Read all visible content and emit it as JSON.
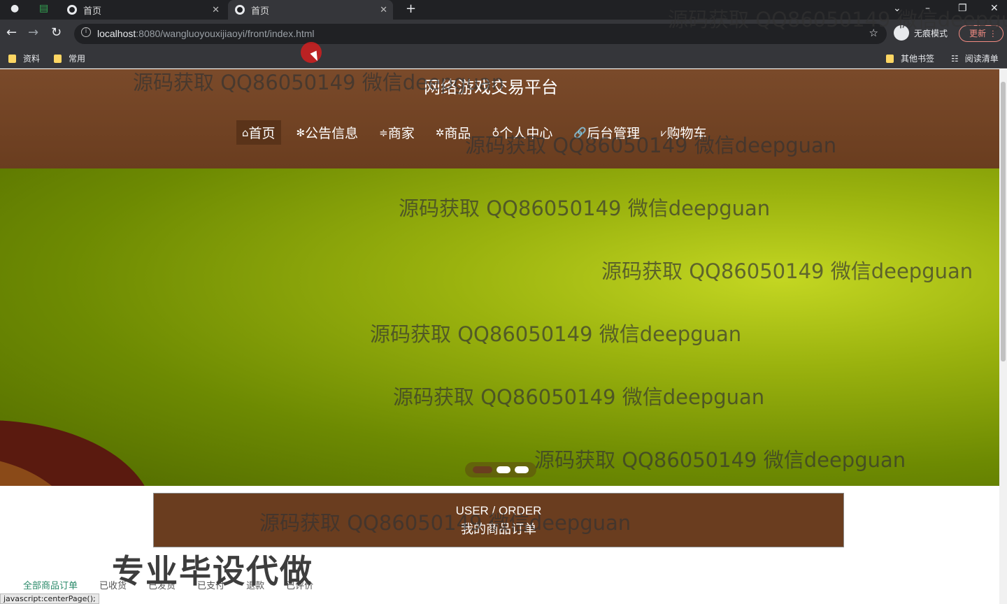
{
  "browser": {
    "tabs": [
      {
        "title": "首页",
        "active": false
      },
      {
        "title": "首页",
        "active": true
      }
    ],
    "url_host": "localhost",
    "url_path": ":8080/wangluoyouxijiaoyi/front/index.html",
    "incognito_label": "无痕模式",
    "update_label": "更新",
    "bookmarks": [
      "资料",
      "常用"
    ],
    "bookmarks_right": [
      "其他书签",
      "阅读清单"
    ],
    "status_text": "javascript:centerPage();"
  },
  "site": {
    "title": "网络游戏交易平台",
    "nav": [
      {
        "label": "首页",
        "icon": "home-icon",
        "glyph": "⌂",
        "active": true
      },
      {
        "label": "公告信息",
        "icon": "snowflake-icon",
        "glyph": "✻"
      },
      {
        "label": "商家",
        "icon": "list-icon",
        "glyph": "≑"
      },
      {
        "label": "商品",
        "icon": "gear-icon",
        "glyph": "✲"
      },
      {
        "label": "个人中心",
        "icon": "user-icon",
        "glyph": "♁"
      },
      {
        "label": "后台管理",
        "icon": "link-icon",
        "glyph": "🔗"
      },
      {
        "label": "购物车",
        "icon": "cart-icon",
        "glyph": "⩗"
      }
    ]
  },
  "order": {
    "title_en": "USER / ORDER",
    "title_cn": "我的商品订单",
    "tabs": [
      "全部商品订单",
      "已收货",
      "已发货",
      "已支付",
      "退款",
      "已评价"
    ]
  },
  "watermark": "源码获取 QQ86050149 微信deepguan",
  "promo": "专业毕设代做",
  "colors": {
    "header": "#6a3d1f",
    "banner": "#9ab20e",
    "accent_tab": "#2b8a6a"
  }
}
